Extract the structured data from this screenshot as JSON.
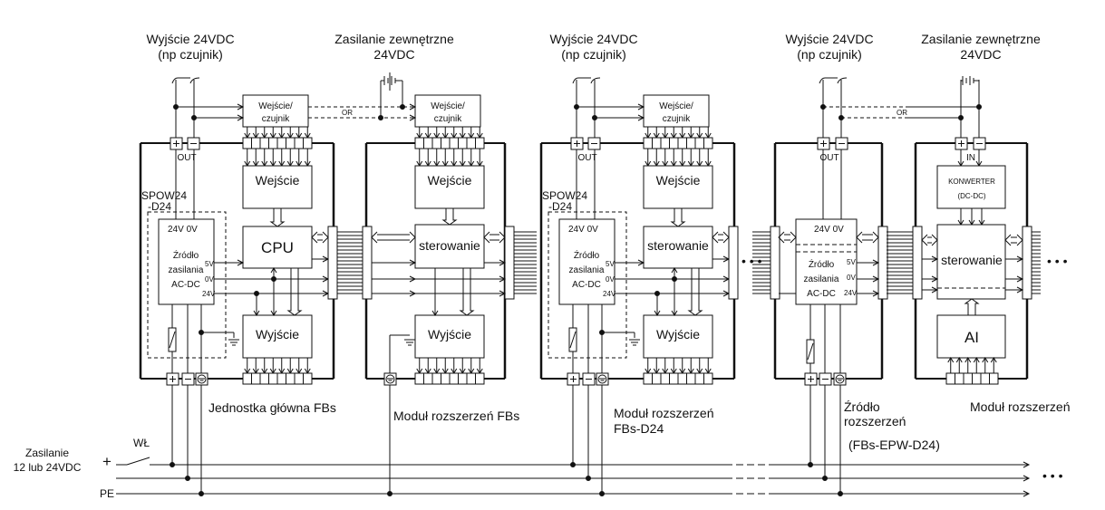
{
  "top_labels": {
    "out1": [
      "Wyjście 24VDC",
      "(np czujnik)"
    ],
    "ext1": [
      "Zasilanie zewnętrzne",
      "24VDC"
    ],
    "out2": [
      "Wyjście 24VDC",
      "(np czujnik)"
    ],
    "out3": [
      "Wyjście 24VDC",
      "(np czujnik)"
    ],
    "ext2": [
      "Zasilanie zewnętrzne",
      "24VDC"
    ]
  },
  "blocks": {
    "sensor": "Wejście/",
    "sensor2": "czujnik",
    "input": "Wejście",
    "cpu": "CPU",
    "control": "sterowanie",
    "output": "Wyjście",
    "converter": [
      "KONWERTER",
      "(DC-DC)"
    ],
    "ai": "AI",
    "psu_model": [
      "SPOW24",
      "-D24"
    ],
    "psu": [
      "24V  0V",
      "Źródło",
      "zasilania",
      "AC-DC"
    ],
    "psu_out": [
      "5V",
      "0V",
      "24V"
    ],
    "out_label": "OUT",
    "in_label": "IN",
    "or_label": "OR",
    "fuse": "F"
  },
  "module_labels": {
    "main": "Jednostka główna FBs",
    "exp1": "Moduł rozszerzeń FBs",
    "exp2": [
      "Moduł rozszerzeń",
      "FBs-D24"
    ],
    "source": [
      "Źródło",
      "rozszerzeń",
      "(FBs-EPW-D24)"
    ],
    "exp3": "Moduł rozszerzeń"
  },
  "supply": {
    "label": [
      "Zasilanie",
      "12 lub 24VDC"
    ],
    "switch": "WŁ",
    "plus": "+",
    "pe": "PE",
    "ellipsis": "• • •"
  }
}
